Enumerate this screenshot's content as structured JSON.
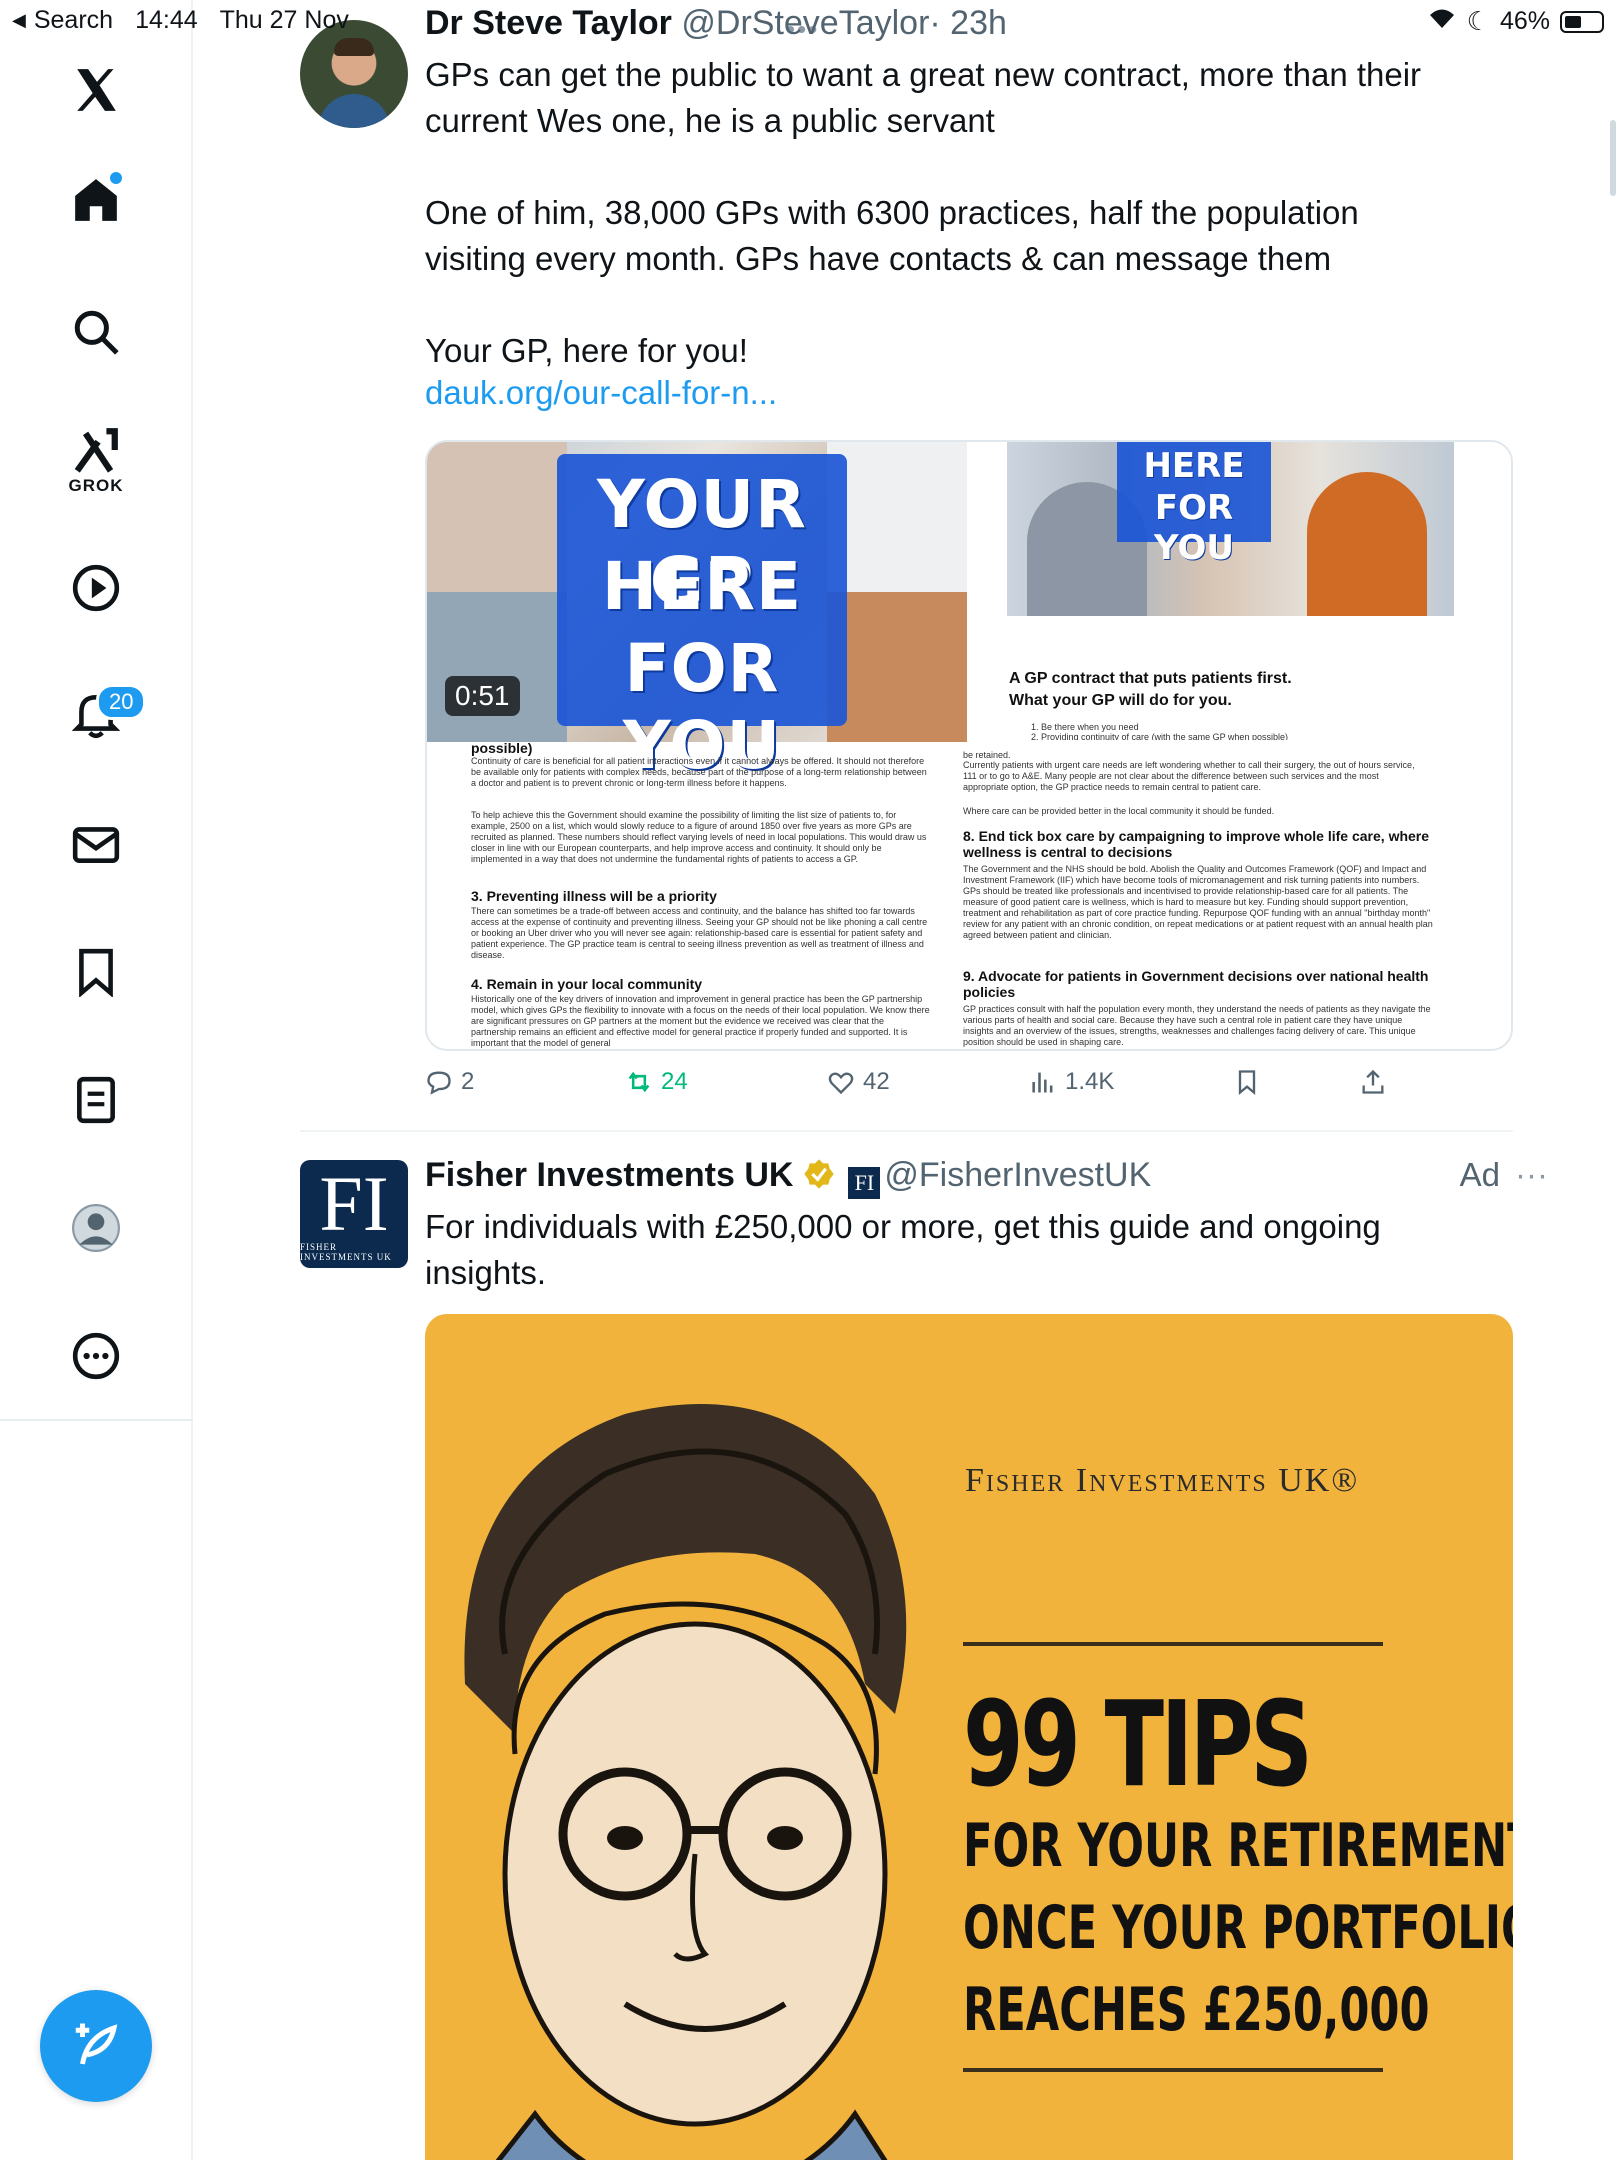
{
  "status_bar": {
    "back_label": "Search",
    "time": "14:44",
    "date": "Thu 27 Nov",
    "battery": "46%",
    "battery_level": 0.46
  },
  "sidebar": {
    "grok_label": "GROK",
    "notifications_count": "20"
  },
  "tweet": {
    "author": "Dr Steve Taylor",
    "handle": "@DrSteveTaylor",
    "time": "· 23h",
    "lines": [
      "GPs can get the public to want a great new contract, more than their",
      "current Wes one, he is a public servant",
      "One of him, 38,000 GPs with 6300 practices, half the population",
      "visiting every month. GPs have contacts & can message them",
      "Your GP, here for you!"
    ],
    "link": "dauk.org/our-call-for-n...",
    "media": {
      "video_duration": "0:51",
      "left_banner": [
        "YOUR GP",
        "HERE",
        "FOR YOU"
      ],
      "right_banner": [
        "HERE",
        "FOR YOU"
      ],
      "right_heading_1": "A GP contract that puts patients first.",
      "right_heading_2": "What your GP will do for you.",
      "right_list_1": "1.    Be there when you need",
      "right_list_2": "2.    Providing continuity of care (with the same GP when possible)",
      "left_possible": "possible)",
      "left_para_1": "Continuity of care is beneficial for all patient interactions even if it cannot always be offered. It should not therefore be available only for patients with complex needs, because part of the purpose of a long-term relationship between a doctor and patient is to prevent chronic or long-term illness before it happens.",
      "left_para_2": "To help achieve this the Government should examine the possibility of limiting the list size of patients to, for example, 2500 on a list, which would slowly reduce to a figure of around 1850 over five years as more GPs are recruited as planned. These numbers should reflect varying levels of need in local populations. This would draw us closer in line with our European counterparts, and help improve access and continuity. It should only be implemented in a way that does not undermine the fundamental rights of patients to access a GP.",
      "left_heading_3": "3. Preventing illness will be a priority",
      "left_para_3": "There can sometimes be a trade-off between access and continuity, and the balance has shifted too far towards access at the expense of continuity and preventing illness. Seeing your GP should not be like phoning a call centre or booking an Uber driver who you will never see again: relationship-based care is essential for patient safety and patient experience. The GP practice team is central to seeing illness prevention as well as treatment of illness and disease.",
      "left_heading_4": "4. Remain in your local community",
      "left_para_4": "Historically one of the key drivers of innovation and improvement in general practice has been the GP partnership model, which gives GPs the flexibility to innovate with a focus on the needs of their local population. We know there are significant pressures on GP partners at the moment but the evidence we received was clear that the partnership remains an efficient and effective model for general practice if properly funded and supported. It is important that the model of general",
      "right_para_a": "be retained.",
      "right_para_b": "Currently patients with urgent care needs are left wondering whether to call their surgery, the out of hours service, 111 or to go to A&E. Many people are not clear about the difference between such services and the most appropriate option, the GP practice needs to remain central to patient care.",
      "right_para_c": "Where care can be provided better in the local community it should be funded.",
      "right_heading_8": "8. End tick box care by campaigning to improve whole life care, where wellness is central to decisions",
      "right_para_8": "The Government and the NHS should be bold. Abolish the Quality and Outcomes Framework (QOF) and Impact and Investment Framework (IIF) which have become tools of micromanagement and risk turning patients into numbers. GPs should be treated like professionals and incentivised to provide relationship-based care for all patients. The measure of good patient care is wellness, which is hard to measure but key. Funding should support prevention, treatment and rehabilitation as part of core practice funding. Repurpose QOF funding with an annual \"birthday month\" review for any patient with an chronic condition, on repeat medications or at patient request with an annual health plan agreed between patient and clinician.",
      "right_heading_9": "9. Advocate for patients in Government decisions over national health policies",
      "right_para_9": "GP practices consult with half the population every month, they understand the needs of patients as they navigate the various parts of health and social care. Because they have such a central role in patient care they have unique insights and an overview of the issues, strengths, weaknesses and challenges facing delivery of care. This unique position should be used in shaping care."
    },
    "actions": {
      "replies": "2",
      "retweets": "24",
      "likes": "42",
      "views": "1.4K"
    }
  },
  "ad": {
    "author": "Fisher Investments UK",
    "handle": "@FisherInvestUK",
    "ad_label": "Ad",
    "more": "···",
    "avatar_mark": "FI",
    "avatar_sub": "FISHER INVESTMENTS UK",
    "lines": [
      "For individuals with £250,000 or more, get this guide and ongoing",
      "insights."
    ],
    "creative": {
      "brand": "Fisher Investments UK®",
      "big": "99 TIPS",
      "line1": "FOR YOUR RETIREMENT",
      "line2": "ONCE YOUR PORTFOLIO",
      "line3": "REACHES £250,000"
    }
  },
  "colors": {
    "accent": "#1d9bf0",
    "retweet": "#00ba7c",
    "ad_background": "#f2b33d",
    "banner_blue": "#1c56d6"
  },
  "icons": [
    "x-logo-icon",
    "home-icon",
    "search-icon",
    "grok-icon",
    "play-icon",
    "bell-icon",
    "mail-icon",
    "bookmark-icon",
    "lists-icon",
    "profile-icon",
    "more-icon",
    "compose-icon",
    "reply-icon",
    "retweet-icon",
    "like-icon",
    "views-icon",
    "share-icon",
    "verified-icon",
    "wifi-icon",
    "moon-icon",
    "battery-icon"
  ]
}
